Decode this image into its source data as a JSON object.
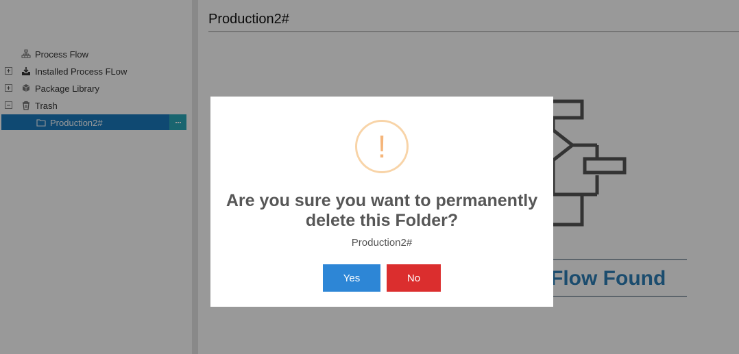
{
  "sidebar": {
    "items": [
      {
        "label": "Process Flow",
        "icon": "sitemap-icon",
        "toggle": "none"
      },
      {
        "label": "Installed Process FLow",
        "icon": "inbox-download-icon",
        "toggle": "plus"
      },
      {
        "label": "Package Library",
        "icon": "cubes-icon",
        "toggle": "plus"
      },
      {
        "label": "Trash",
        "icon": "trash-icon",
        "toggle": "minus"
      }
    ],
    "selected_item": {
      "label": "Production2#",
      "icon": "folder-icon"
    }
  },
  "main": {
    "page_title": "Production2#",
    "empty_state_text": "s Flow Found"
  },
  "dialog": {
    "icon": "warning-icon",
    "icon_glyph": "!",
    "title": "Are you sure you want to permanently delete this Folder?",
    "message": "Production2#",
    "yes_label": "Yes",
    "no_label": "No"
  },
  "colors": {
    "selected_bg": "#1a7bbf",
    "more_button_bg": "#2aa8ba",
    "yes_button": "#2d86d6",
    "no_button": "#db2e2e",
    "warning": "#f5b57a",
    "empty_state_text": "#2d7fb8"
  }
}
